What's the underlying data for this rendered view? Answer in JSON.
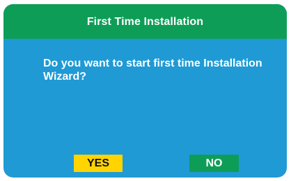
{
  "dialog": {
    "title": "First Time Installation",
    "message": "Do you want to start first time Installation Wizard?",
    "buttons": {
      "yes_label": "YES",
      "no_label": "NO"
    },
    "colors": {
      "title_bar": "#0e9d57",
      "body": "#1f9ad4",
      "yes_button": "#ffd400",
      "no_button": "#0e9d57"
    },
    "selected_button": "YES"
  }
}
